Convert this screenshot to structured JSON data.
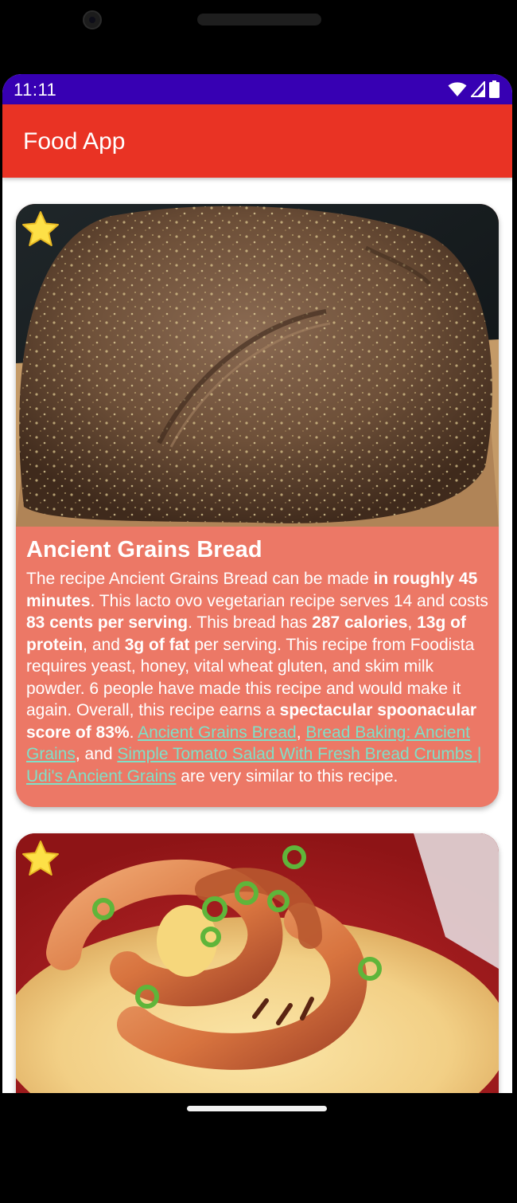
{
  "status_bar": {
    "time": "11:11"
  },
  "app_bar": {
    "title": "Food App"
  },
  "colors": {
    "status_bar": "#3700b3",
    "app_bar": "#e93324",
    "card": "#ec7866",
    "link": "#7fe0c8",
    "star": "#fde047"
  },
  "recipes": [
    {
      "title": "Ancient Grains Bread",
      "image": "bread-loaf-image",
      "favorite_icon": "star-icon",
      "summary": {
        "t1": "The recipe Ancient Grains Bread can be made ",
        "b1": "in roughly 45 minutes",
        "t2": ". This lacto ovo vegetarian recipe serves 14 and costs ",
        "b2": "83 cents per serving",
        "t3": ". This bread has ",
        "b3": "287 calories",
        "t4": ", ",
        "b4": "13g of protein",
        "t5": ", and ",
        "b5": "3g of fat",
        "t6": " per serving. This recipe from Foodista requires yeast, honey, vital wheat gluten, and skim milk powder. 6 people have made this recipe and would make it again. Overall, this recipe earns a ",
        "b6": "spectacular spoonacular score of 83%",
        "t7": ". ",
        "link1": "Ancient Grains Bread",
        "t8": ", ",
        "link2": "Bread Baking: Ancient Grains",
        "t9": ", and ",
        "link3": "Simple Tomato Salad With Fresh Bread Crumbs | Udi's Ancient Grains",
        "t10": " are very similar to this recipe."
      }
    },
    {
      "image": "shrimp-and-grits-image",
      "favorite_icon": "star-icon"
    }
  ]
}
